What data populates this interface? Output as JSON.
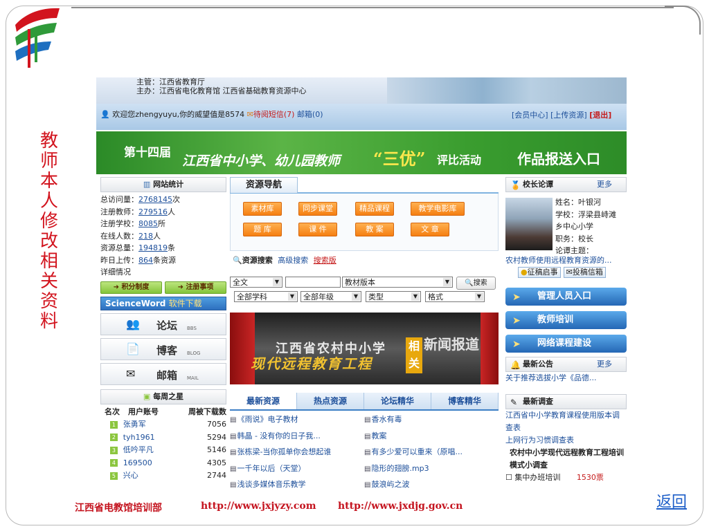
{
  "slide": {
    "side_title": "教师本人修改相关资料",
    "back_link": "返回",
    "footer_org": "江西省电教馆培训部",
    "footer_url1": "http://www.jxjyzy.com",
    "footer_url2": "http://www.jxdjg.gov.cn"
  },
  "site": {
    "sponsor_line1": "主管：江西省教育厅",
    "sponsor_line2": "主办：江西省电化教育馆   江西省基础教育资源中心",
    "welcome": "欢迎您zhengyuyu,你的威望值是8574",
    "messages": "待阅短信(7)",
    "mailbox": "邮箱(0)",
    "member_center": "[会员中心]",
    "upload": "[上传资源]",
    "logout": "[退出]",
    "banner": {
      "part1": "第十四届",
      "part2": "江西省中小学、幼儿园教师",
      "part3": "“三优”",
      "part4": "评比活动",
      "part5": "作品报送入口"
    }
  },
  "stats": {
    "title": "网站统计",
    "visits_label": "总访问量：",
    "visits": "2768145",
    "visits_unit": "次",
    "teachers_label": "注册教师：",
    "teachers": "279516",
    "teachers_unit": "人",
    "schools_label": "注册学校：",
    "schools": "8085",
    "schools_unit": "所",
    "online_label": "在线人数：",
    "online": "218",
    "online_unit": "人",
    "resources_label": "资源总量：",
    "resources": "194819",
    "resources_unit": "条",
    "yesterday_label": "昨日上传：",
    "yesterday": "864",
    "yesterday_unit": "条资源",
    "details": "详细情况"
  },
  "left": {
    "points_btn": "积分制度",
    "register_btn": "注册事项",
    "sciword": "ScienceWord",
    "sciword_sub": "软件下载",
    "forum": "论坛",
    "forum_sub": "BBS",
    "blog": "博客",
    "blog_sub": "BLOG",
    "mail": "邮箱",
    "mail_sub": "MAIL",
    "weekly_title": "每周之星",
    "col_rank": "名次",
    "col_user": "用户账号",
    "col_downloads": "周被下载数",
    "weekly": [
      {
        "rank": "1",
        "user": "张勇军",
        "count": "7056"
      },
      {
        "rank": "2",
        "user": "tyh1961",
        "count": "5294"
      },
      {
        "rank": "3",
        "user": "低吟平凡",
        "count": "5146"
      },
      {
        "rank": "4",
        "user": "169500",
        "count": "4305"
      },
      {
        "rank": "5",
        "user": "兴心",
        "count": "2744"
      }
    ]
  },
  "mid": {
    "nav_title": "资源导航",
    "buttons": [
      "素材库",
      "同步课堂",
      "精品课程",
      "教学电影库",
      "题 库",
      "课 件",
      "教 案",
      "文 章"
    ],
    "search_title": "资源搜索",
    "advanced": "高级搜索",
    "search_edition": "搜索版",
    "sel_scope": "全文",
    "sel_version": "教材版本",
    "search_btn": "搜索",
    "sel_subject": "全部学科",
    "sel_grade": "全部年级",
    "sel_type": "类型",
    "sel_format": "格式",
    "promo_line1": "江西省农村中小学",
    "promo_line2": "现代远程教育工程",
    "promo_tag": "相关",
    "promo_news": "新闻报道",
    "tabs": [
      "最新资源",
      "热点资源",
      "论坛精华",
      "博客精华"
    ],
    "list_left": [
      "《雨说》电子教材",
      "韩晶 - 没有你的日子我...",
      "张栋梁-当你孤单你会想起谁",
      "一千年以后（天堂）",
      "浅谈多媒体音乐教学"
    ],
    "list_right": [
      "香水有毒",
      "教案",
      "有多少爱可以重来（原唱...",
      "隐形的翅膀.mp3",
      "鼓浪屿之波"
    ]
  },
  "right": {
    "forum_title": "校长论谭",
    "more1": "更多",
    "name": "姓名：叶银河",
    "school": "学校：浮梁县峙滩",
    "school2": "乡中心小学",
    "job": "职务：校长",
    "topic": "论谭主题：",
    "topic_link": "农村教师使用远程教育资源的...",
    "btn_call": "征稿启事",
    "btn_submit": "投稿信箱",
    "admin_entry": "管理人员入口",
    "teacher_train": "教师培训",
    "course_build": "网络课程建设",
    "notice_title": "最新公告",
    "more2": "更多",
    "notice": "关于推荐选拔小学《品德...",
    "survey_title": "最新调查",
    "survey1": "江西省中小学教育课程使用版本调查表",
    "survey2": "上网行为习惯调查表",
    "survey3": "农村中小学现代远程教育工程培训模式小调查",
    "survey_option": "集中办班培训",
    "survey_votes": "1530票"
  },
  "colors": {
    "accent_red": "#d2141e",
    "link_blue": "#1d4f9a",
    "banner_green": "#3a9d2f"
  }
}
